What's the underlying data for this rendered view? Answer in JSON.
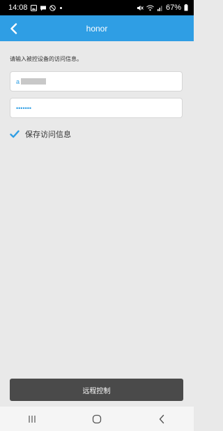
{
  "status_bar": {
    "time": "14:08",
    "battery": "67%",
    "left_icons": [
      "image-icon",
      "chat-icon",
      "blocked-icon"
    ],
    "right_icons": [
      "mute-icon",
      "wifi-icon",
      "signal-icon",
      "battery-icon"
    ]
  },
  "header": {
    "title": "honor",
    "back_icon": "chevron-left-icon"
  },
  "form": {
    "instruction": "请输入被控设备的访问信息。",
    "username_value": "a",
    "password_value": "•••••••",
    "save_checked": true,
    "save_label": "保存访问信息"
  },
  "remote_button_label": "远程控制",
  "nav_bar": {
    "buttons": [
      "recents-icon",
      "home-icon",
      "back-icon"
    ]
  },
  "colors": {
    "header_bg": "#2f9ee4",
    "accent": "#2f9ee4",
    "button_bg": "#4a4a4a",
    "page_bg": "#e9e9e9"
  }
}
